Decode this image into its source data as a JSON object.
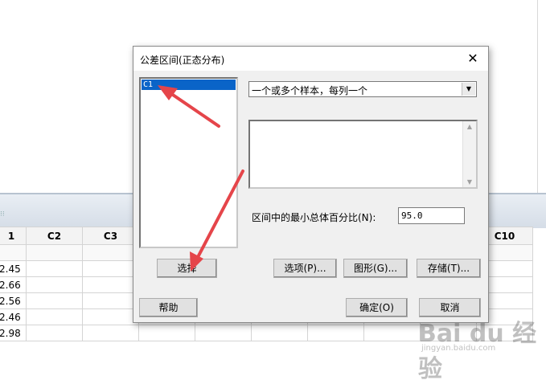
{
  "worksheet": {
    "columns": [
      "1",
      "C2",
      "C3",
      "",
      "",
      "",
      "",
      "",
      "",
      "C10"
    ],
    "rows": [
      [
        "2.45"
      ],
      [
        "2.66"
      ],
      [
        "2.56"
      ],
      [
        "2.46"
      ],
      [
        "2.98"
      ]
    ]
  },
  "dialog": {
    "title": "公差区间(正态分布)",
    "variables": [
      "C1"
    ],
    "data_mode": "一个或多个样本，每列一个",
    "percent_label": "区间中的最小总体百分比(N):",
    "percent_value": "95.0",
    "buttons": {
      "select": "选择",
      "options": "选项(P)...",
      "graphs": "图形(G)...",
      "storage": "存储(T)...",
      "help": "帮助",
      "ok": "确定(O)",
      "cancel": "取消"
    }
  },
  "watermark": {
    "logo": "Bai du 经验",
    "url": "jingyan.baidu.com"
  },
  "colors": {
    "selection": "#0a64c8",
    "arrow": "#e5454a",
    "dialog_bg": "#f0f0f0"
  }
}
